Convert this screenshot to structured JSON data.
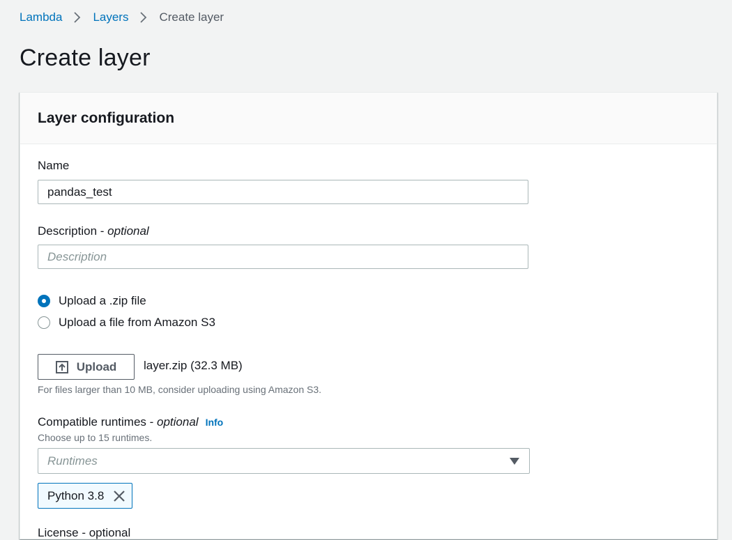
{
  "breadcrumb": {
    "items": [
      "Lambda",
      "Layers"
    ],
    "current": "Create layer"
  },
  "page": {
    "title": "Create layer"
  },
  "panel": {
    "title": "Layer configuration"
  },
  "form": {
    "name": {
      "label": "Name",
      "value": "pandas_test"
    },
    "description": {
      "label": "Description",
      "optional": "optional",
      "separator": " - ",
      "placeholder": "Description",
      "value": ""
    },
    "source_options": [
      {
        "label": "Upload a .zip file",
        "selected": true
      },
      {
        "label": "Upload a file from Amazon S3",
        "selected": false
      }
    ],
    "upload": {
      "button_label": "Upload",
      "file_name": "layer.zip (32.3 MB)",
      "hint": "For files larger than 10 MB, consider uploading using Amazon S3."
    },
    "runtimes": {
      "label": "Compatible runtimes",
      "separator": " - ",
      "optional": "optional",
      "info": "Info",
      "description": "Choose up to 15 runtimes.",
      "placeholder": "Runtimes",
      "selected": [
        "Python 3.8"
      ]
    },
    "next_label": "License - optional"
  },
  "colors": {
    "link": "#0073bb",
    "background": "#f2f3f3",
    "text": "#16191f",
    "muted": "#687078",
    "border": "#aab7b8"
  }
}
